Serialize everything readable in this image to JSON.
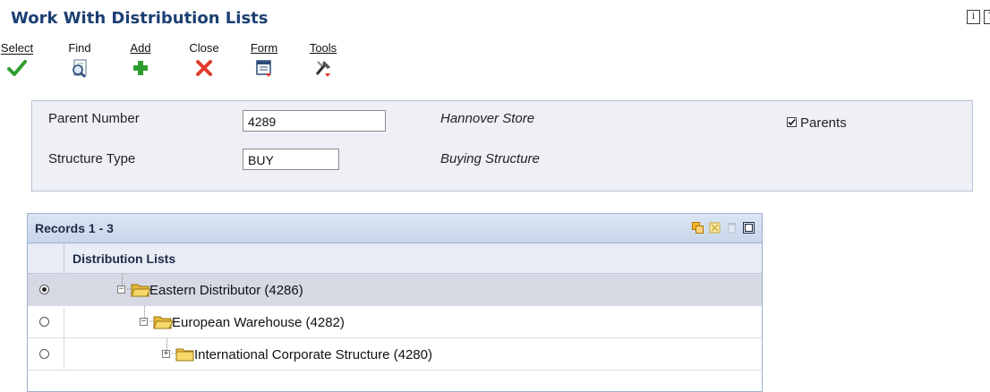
{
  "window": {
    "title": "Work With Distribution Lists"
  },
  "header_icons": [
    {
      "icon": "info-icon",
      "glyph": "i"
    },
    {
      "icon": "help-icon",
      "glyph": "?"
    }
  ],
  "toolbar": {
    "select_label": "Select",
    "find_label": "Find",
    "add_label": "Add",
    "close_label": "Close",
    "form_label": "Form",
    "tools_label": "Tools"
  },
  "form": {
    "parent_number_label": "Parent Number",
    "parent_number_value": "4289",
    "parent_number_desc": "Hannover Store",
    "structure_type_label": "Structure Type",
    "structure_type_value": "BUY",
    "structure_type_desc": "Buying Structure",
    "parents_label": "Parents",
    "parents_checked": true
  },
  "grid": {
    "title": "Records 1 - 3",
    "column_header": "Distribution Lists",
    "rows": [
      {
        "label": "Eastern Distributor (4286)",
        "selected": true,
        "expanded": true,
        "level": 0
      },
      {
        "label": "European Warehouse (4282)",
        "selected": false,
        "expanded": true,
        "level": 1
      },
      {
        "label": "International Corporate Structure (4280)",
        "selected": false,
        "expanded": false,
        "level": 2
      }
    ]
  },
  "colors": {
    "title": "#1c3f73",
    "accent_green": "#2f9e2f",
    "close_red": "#e23a2a"
  }
}
